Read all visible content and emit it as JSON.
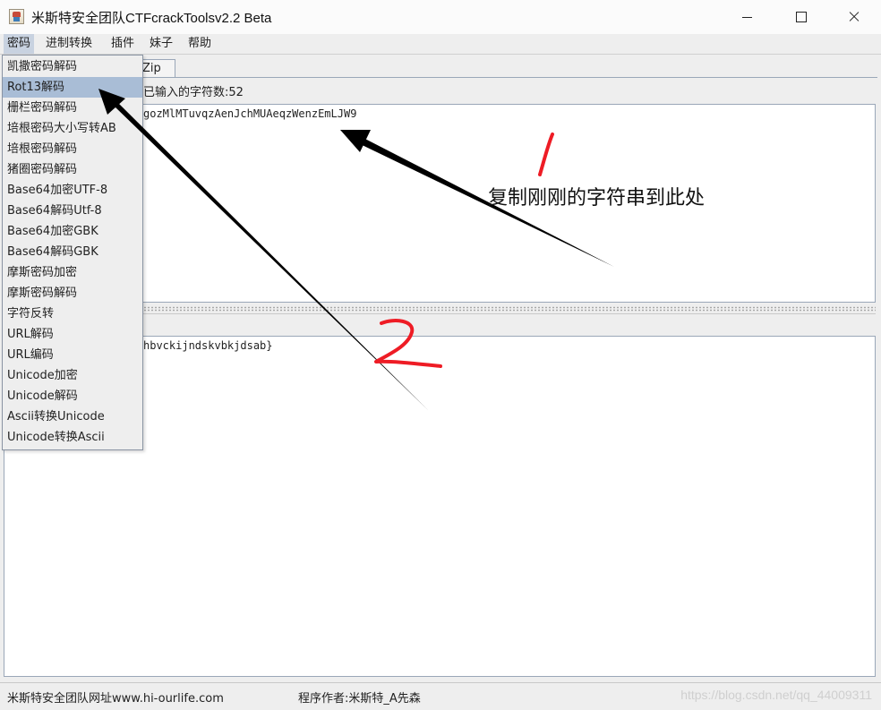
{
  "window": {
    "title": "米斯特安全团队CTFcrackToolsv2.2 Beta"
  },
  "menubar": {
    "items": [
      "密码",
      "进制转换",
      "插件",
      "妹子",
      "帮助"
    ],
    "active_index": 0
  },
  "tab": {
    "visible_label": "Zip"
  },
  "input_panel": {
    "char_count_label": "已输入的字符数:52",
    "visible_text": "gozMlMTuvqzAenJchMUAeqzWenzEmLJW9"
  },
  "output_panel": {
    "visible_text": "hbvckijndskvbkjdsab}"
  },
  "dropdown": {
    "selected_index": 1,
    "items": [
      "凯撒密码解码",
      "Rot13解码",
      "栅栏密码解码",
      "培根密码大小写转AB",
      "培根密码解码",
      "猪圈密码解码",
      "Base64加密UTF-8",
      "Base64解码Utf-8",
      "Base64加密GBK",
      "Base64解码GBK",
      "摩斯密码加密",
      "摩斯密码解码",
      "字符反转",
      "URL解码",
      "URL编码",
      "Unicode加密",
      "Unicode解码",
      "Ascii转换Unicode",
      "Unicode转换Ascii"
    ]
  },
  "statusbar": {
    "website": "米斯特安全团队网址www.hi-ourlife.com",
    "author": "程序作者:米斯特_A先森",
    "watermark": "https://blog.csdn.net/qq_44009311"
  },
  "annotations": {
    "caption": "复制刚刚的字符串到此处",
    "number_1": "1",
    "number_2": "2",
    "ink_color": "#ee1c25"
  }
}
